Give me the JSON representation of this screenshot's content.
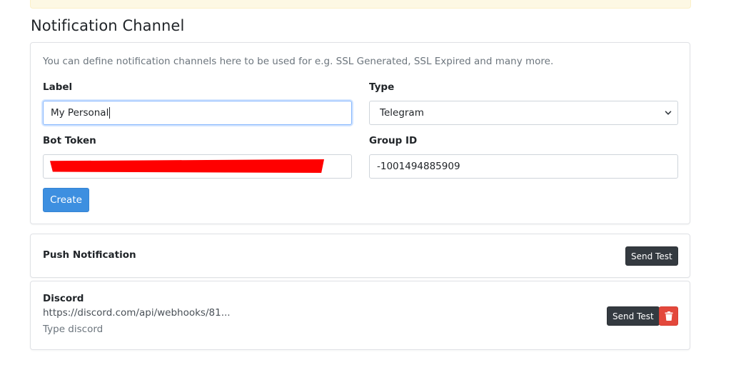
{
  "page": {
    "title": "Notification Channel"
  },
  "form": {
    "intro": "You can define notification channels here to be used for e.g. SSL Generated, SSL Expired and many more.",
    "label_label": "Label",
    "label_value": "My Personal",
    "type_label": "Type",
    "type_value": "Telegram",
    "bot_token_label": "Bot Token",
    "group_id_label": "Group ID",
    "group_id_value": "-1001494885909",
    "create_label": "Create"
  },
  "channels": [
    {
      "name": "Push Notification",
      "send_test_label": "Send Test"
    },
    {
      "name": "Discord",
      "url": "https://discord.com/api/webhooks/81...",
      "type_text": "Type discord",
      "send_test_label": "Send Test"
    }
  ],
  "colors": {
    "primary": "#3d8fe0",
    "dark": "#343a40",
    "danger": "#e3483c",
    "redaction": "#ff0000"
  },
  "icons": {
    "select_arrow": "chevron-down-icon",
    "delete": "trash-icon"
  }
}
